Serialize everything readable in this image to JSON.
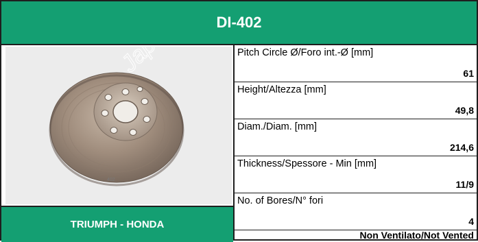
{
  "product": {
    "code": "DI-402",
    "brand_applications": "TRIUMPH - HONDA",
    "photo_watermark": "JapanParts",
    "photo_part_number": "402"
  },
  "specs": [
    {
      "label": "Pitch Circle Ø/Foro int.-Ø [mm]",
      "value": "61"
    },
    {
      "label": "Height/Altezza [mm]",
      "value": "49,8"
    },
    {
      "label": "Diam./Diam. [mm]",
      "value": "214,6"
    },
    {
      "label": "Thickness/Spessore - Min [mm]",
      "value": "11/9"
    },
    {
      "label": "No. of Bores/N° fori",
      "value": "4"
    }
  ],
  "ventilation": "Non Ventilato/Not Vented",
  "colors": {
    "header_green": "#149f72",
    "border": "#1e1e1e",
    "disc_metal": "#9a8a7c"
  },
  "icons": [
    "brake-disc-photo"
  ]
}
